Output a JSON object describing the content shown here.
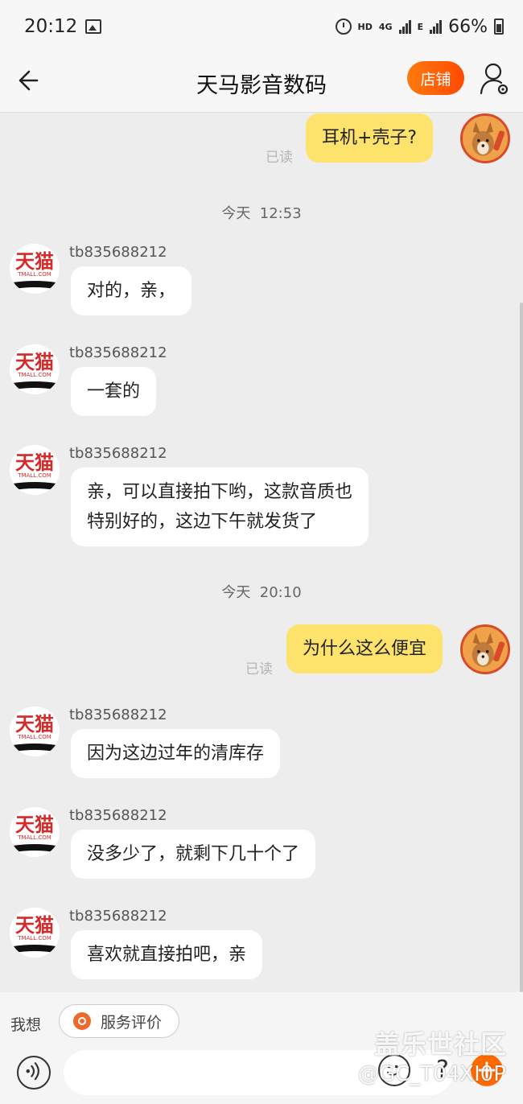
{
  "status_bar": {
    "time": "20:12",
    "hd": "HD",
    "network": "4G",
    "network2": "E",
    "battery": "66%"
  },
  "header": {
    "title": "天马影音数码",
    "store_label": "店铺"
  },
  "chat": {
    "seller_name": "tb835688212",
    "read_label": "已读",
    "messages": [
      {
        "text": "耳机+壳子?"
      },
      {
        "text": "对的，亲，"
      },
      {
        "text": "一套的"
      },
      {
        "text": "亲，可以直接拍下哟，这款音质也",
        "text2": "特别好的，这边下午就发货了"
      },
      {
        "text": "为什么这么便宜"
      },
      {
        "text": "因为这边过年的清库存"
      },
      {
        "text": "没多少了，就剩下几十个了"
      },
      {
        "text": "喜欢就直接拍吧，亲"
      }
    ],
    "dividers": [
      {
        "label": "今天",
        "time": "12:53"
      },
      {
        "label": "今天",
        "time": "20:10"
      }
    ]
  },
  "quick_bar": {
    "label": "我想",
    "service_label": "服务评价"
  },
  "input": {
    "placeholder": ""
  },
  "watermark": {
    "brand": "盖乐世社区",
    "user": "@GC_T04XI0P"
  },
  "icons": {
    "back": "back-arrow-icon",
    "profile": "user-settings-icon",
    "voice": "voice-icon",
    "emoji": "emoji-icon",
    "more": "plus-icon"
  },
  "colors": {
    "accent": "#ff5a00",
    "outgoing_bubble": "#fde36b",
    "incoming_bubble": "#ffffff",
    "background": "#ededed"
  }
}
